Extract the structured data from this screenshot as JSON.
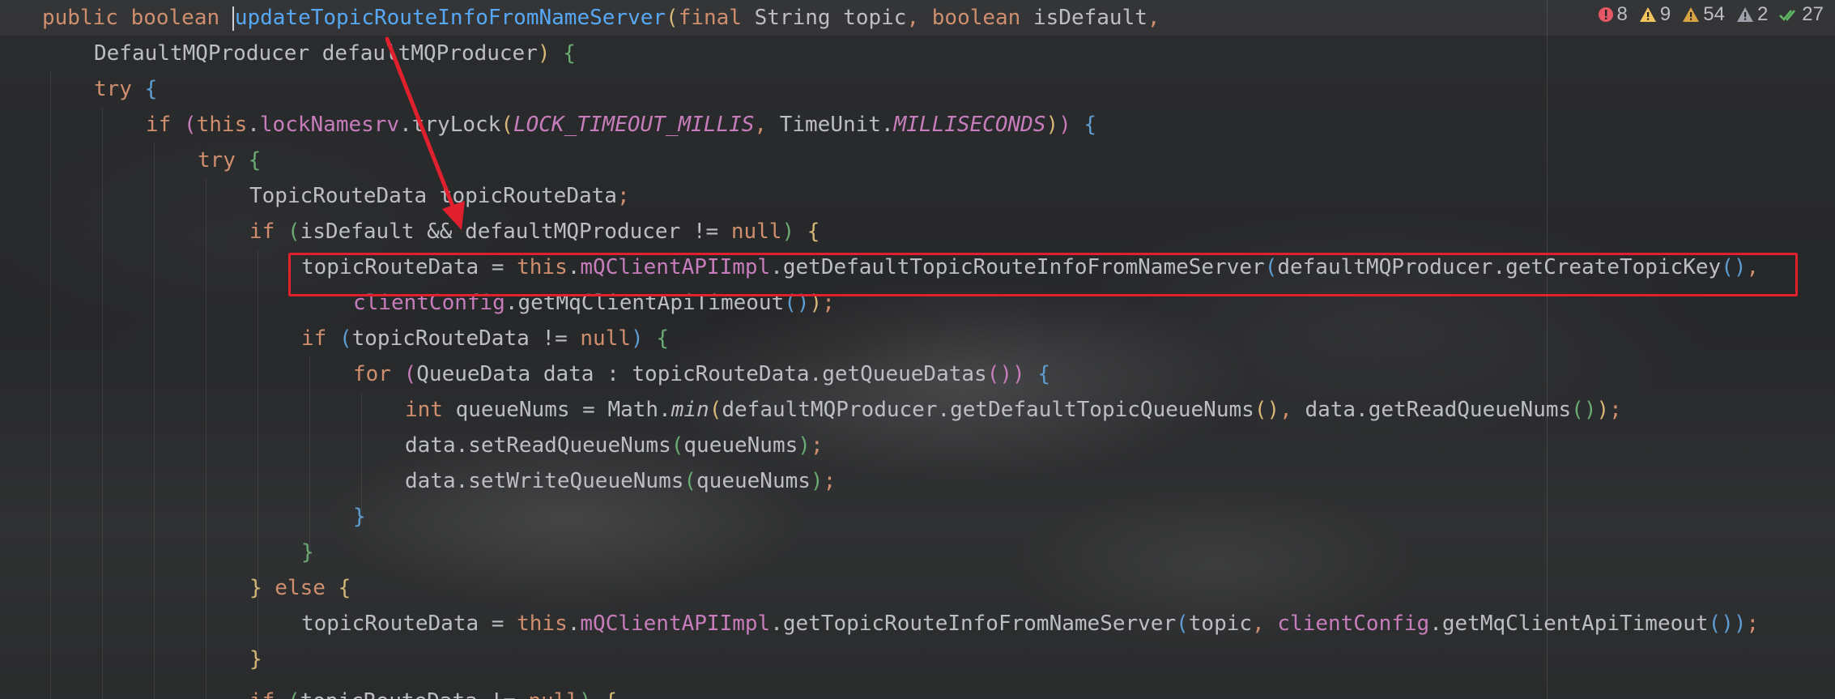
{
  "inspections": {
    "errors": "8",
    "warnings": "9",
    "weak_warnings": "54",
    "typos": "2",
    "ok": "27"
  },
  "colors": {
    "keyword": "#cf8e6d",
    "method": "#56a8f5",
    "field": "#c77dbb",
    "text": "#bcbec4",
    "annotation_red": "#e0212d"
  },
  "code": {
    "lines": [
      {
        "t": [
          [
            "kw",
            "public boolean "
          ],
          [
            "caret",
            ""
          ],
          [
            "fn",
            "updateTopicRouteInfoFromNameServer"
          ],
          [
            "p1",
            "("
          ],
          [
            "kw",
            "final "
          ],
          [
            "",
            "String topic"
          ],
          [
            "kw",
            ", boolean "
          ],
          [
            "",
            "isDefault"
          ],
          [
            "kw",
            ","
          ]
        ]
      },
      {
        "t": [
          [
            "",
            "DefaultMQProducer defaultMQProducer"
          ],
          [
            "p1",
            ")"
          ],
          [
            "",
            " "
          ],
          [
            "p2",
            "{"
          ]
        ]
      },
      {
        "t": [
          [
            "kw",
            "try "
          ],
          [
            "p3",
            "{"
          ]
        ]
      },
      {
        "t": [
          [
            "kw",
            "if "
          ],
          [
            "p4",
            "("
          ],
          [
            "kw",
            "this"
          ],
          [
            "",
            "."
          ],
          [
            "field",
            "lockNamesrv"
          ],
          [
            "",
            ".tryLock"
          ],
          [
            "p1",
            "("
          ],
          [
            "const",
            "LOCK_TIMEOUT_MILLIS"
          ],
          [
            "kw",
            ", "
          ],
          [
            "",
            "TimeUnit."
          ],
          [
            "const",
            "MILLISECONDS"
          ],
          [
            "p1",
            ")"
          ],
          [
            "p4",
            ")"
          ],
          [
            "",
            " "
          ],
          [
            "p3",
            "{"
          ]
        ]
      },
      {
        "t": [
          [
            "kw",
            "try "
          ],
          [
            "p2",
            "{"
          ]
        ]
      },
      {
        "t": [
          [
            "",
            "TopicRouteData topicRouteData"
          ],
          [
            "kw",
            ";"
          ]
        ]
      },
      {
        "t": [
          [
            "kw",
            "if "
          ],
          [
            "p2",
            "("
          ],
          [
            "",
            "isDefault && defaultMQProducer != "
          ],
          [
            "kw",
            "null"
          ],
          [
            "p2",
            ")"
          ],
          [
            "",
            " "
          ],
          [
            "p1",
            "{"
          ]
        ]
      },
      {
        "t": [
          [
            "",
            "topicRouteData = "
          ],
          [
            "kw",
            "this"
          ],
          [
            "",
            "."
          ],
          [
            "field",
            "mQClientAPIImpl"
          ],
          [
            "",
            ".getDefaultTopicRouteInfoFromNameServer"
          ],
          [
            "p3",
            "("
          ],
          [
            "",
            "defaultMQProducer.getCreateTopicKey"
          ],
          [
            "p3",
            "()"
          ],
          [
            "kw",
            ","
          ]
        ]
      },
      {
        "t": [
          [
            "field",
            "clientConfig"
          ],
          [
            "",
            ".getMqClientApiTimeout"
          ],
          [
            "p3",
            "()"
          ],
          [
            "p1",
            ")"
          ],
          [
            "kw",
            ";"
          ]
        ]
      },
      {
        "t": [
          [
            "kw",
            "if "
          ],
          [
            "p3",
            "("
          ],
          [
            "",
            "topicRouteData != "
          ],
          [
            "kw",
            "null"
          ],
          [
            "p3",
            ")"
          ],
          [
            "",
            " "
          ],
          [
            "p2",
            "{"
          ]
        ]
      },
      {
        "t": [
          [
            "kw",
            "for "
          ],
          [
            "p4",
            "("
          ],
          [
            "",
            "QueueData data : topicRouteData.getQueueDatas"
          ],
          [
            "p4",
            "()"
          ],
          [
            "p4",
            ")"
          ],
          [
            "",
            " "
          ],
          [
            "p3",
            "{"
          ]
        ]
      },
      {
        "t": [
          [
            "kw",
            "int "
          ],
          [
            "",
            "queueNums = Math."
          ],
          [
            "static-m",
            "min"
          ],
          [
            "p1",
            "("
          ],
          [
            "",
            "defaultMQProducer.getDefaultTopicQueueNums"
          ],
          [
            "p1",
            "()"
          ],
          [
            "kw",
            ", "
          ],
          [
            "",
            "data.getReadQueueNums"
          ],
          [
            "p2",
            "()"
          ],
          [
            "p1",
            ")"
          ],
          [
            "kw",
            ";"
          ]
        ]
      },
      {
        "t": [
          [
            "",
            "data.setReadQueueNums"
          ],
          [
            "p2",
            "("
          ],
          [
            "",
            "queueNums"
          ],
          [
            "p2",
            ")"
          ],
          [
            "kw",
            ";"
          ]
        ]
      },
      {
        "t": [
          [
            "",
            "data.setWriteQueueNums"
          ],
          [
            "p2",
            "("
          ],
          [
            "",
            "queueNums"
          ],
          [
            "p2",
            ")"
          ],
          [
            "kw",
            ";"
          ]
        ]
      },
      {
        "t": [
          [
            "p3",
            "}"
          ]
        ]
      },
      {
        "t": [
          [
            "p2",
            "}"
          ]
        ]
      },
      {
        "t": [
          [
            "p1",
            "}"
          ],
          [
            "kw",
            " else "
          ],
          [
            "p1",
            "{"
          ]
        ]
      },
      {
        "t": [
          [
            "",
            "topicRouteData = "
          ],
          [
            "kw",
            "this"
          ],
          [
            "",
            "."
          ],
          [
            "field",
            "mQClientAPIImpl"
          ],
          [
            "",
            ".getTopicRouteInfoFromNameServer"
          ],
          [
            "p3",
            "("
          ],
          [
            "",
            "topic"
          ],
          [
            "kw",
            ", "
          ],
          [
            "field",
            "clientConfig"
          ],
          [
            "",
            ".getMqClientApiTimeout"
          ],
          [
            "p3",
            "()"
          ],
          [
            "p3",
            ")"
          ],
          [
            "kw",
            ";"
          ]
        ]
      },
      {
        "t": [
          [
            "p1",
            "}"
          ]
        ]
      },
      {
        "t": [
          [
            "kw",
            "if "
          ],
          [
            "p2",
            "("
          ],
          [
            "",
            "topicRouteData != "
          ],
          [
            "kw",
            "null"
          ],
          [
            "p2",
            ")"
          ],
          [
            "",
            " "
          ],
          [
            "p1",
            "{"
          ]
        ]
      }
    ]
  }
}
